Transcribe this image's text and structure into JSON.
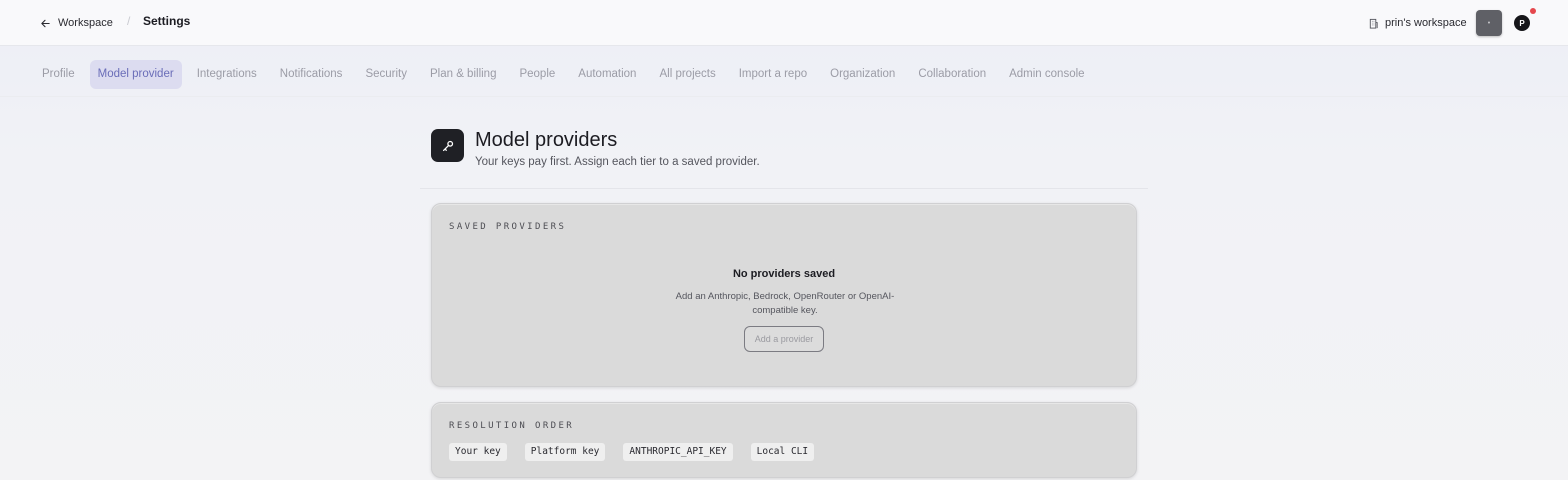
{
  "topbar": {
    "back_label": "Workspace",
    "breadcrumb_separator": "/",
    "page_label": "Settings",
    "workspace_label": "prin's workspace",
    "square_button_glyph": "•",
    "avatar_initial": "P",
    "notification_color": "#e5484d"
  },
  "tabs": [
    {
      "label": "Profile",
      "active": false
    },
    {
      "label": "Model provider",
      "active": true
    },
    {
      "label": "Integrations",
      "active": false
    },
    {
      "label": "Notifications",
      "active": false
    },
    {
      "label": "Security",
      "active": false
    },
    {
      "label": "Plan & billing",
      "active": false
    },
    {
      "label": "People",
      "active": false
    },
    {
      "label": "Automation",
      "active": false
    },
    {
      "label": "All projects",
      "active": false
    },
    {
      "label": "Import a repo",
      "active": false
    },
    {
      "label": "Organization",
      "active": false
    },
    {
      "label": "Collaboration",
      "active": false
    },
    {
      "label": "Admin console",
      "active": false
    }
  ],
  "header": {
    "icon": "key-icon",
    "title": "Model providers",
    "subtitle": "Your keys pay first. Assign each tier to a saved provider."
  },
  "saved_providers": {
    "label": "SAVED PROVIDERS",
    "empty_title": "No providers saved",
    "empty_text": "Add an Anthropic, Bedrock, OpenRouter or OpenAI-compatible key.",
    "add_button": "Add a provider"
  },
  "resolution_order": {
    "label": "RESOLUTION ORDER",
    "items": [
      "Your key",
      "Platform key",
      "ANTHROPIC_API_KEY",
      "Local CLI"
    ]
  },
  "colors": {
    "accent_tab_bg": "#dcdcf0",
    "accent_tab_text": "#6a6db8",
    "card_bg": "#dadada"
  }
}
